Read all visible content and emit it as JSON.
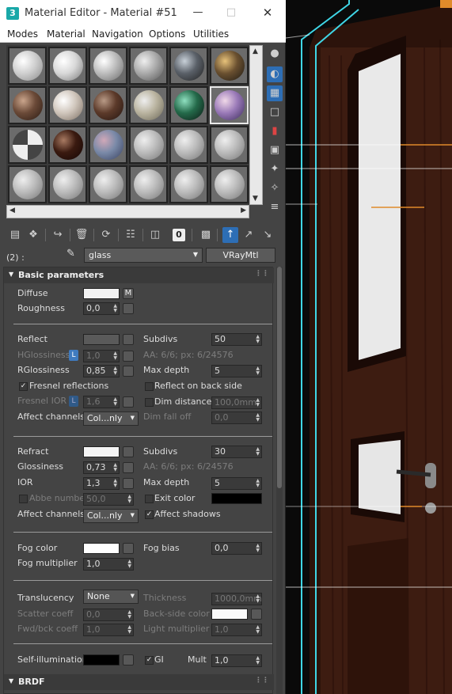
{
  "window": {
    "app_icon": "3",
    "title": "Material Editor - Material #51"
  },
  "menu": [
    "Modes",
    "Material",
    "Navigation",
    "Options",
    "Utilities"
  ],
  "material_row": {
    "slot_label": "(2) :",
    "name": "glass",
    "type": "VRayMtl"
  },
  "basic": {
    "header": "Basic parameters",
    "diffuse_label": "Diffuse",
    "diffuse_map_btn": "M",
    "roughness_label": "Roughness",
    "roughness": "0,0",
    "reflect_label": "Reflect",
    "subdivs_label": "Subdivs",
    "reflect_subdivs": "50",
    "hglossiness_label": "HGlossiness",
    "lock_label": "L",
    "hglossiness": "1,0",
    "aa_info": "AA: 6/6; px: 6/24576",
    "rglossiness_label": "RGlossiness",
    "rglossiness": "0,85",
    "max_depth_label": "Max depth",
    "reflect_max_depth": "5",
    "fresnel_label": "Fresnel reflections",
    "reflect_back_label": "Reflect on back side",
    "fresnel_ior_label": "Fresnel IOR",
    "fresnel_ior": "1,6",
    "dim_distance_label": "Dim distance",
    "dim_distance": "100,0mm",
    "affect_channels_label": "Affect channels",
    "affect_channels": "Col...nly",
    "dim_falloff_label": "Dim fall off",
    "dim_falloff": "0,0",
    "refract_label": "Refract",
    "refract_subdivs": "30",
    "refract_aa_info": "AA: 6/6; px: 6/24576",
    "glossiness_label": "Glossiness",
    "glossiness": "0,73",
    "ior_label": "IOR",
    "ior": "1,3",
    "refract_max_depth": "5",
    "abbe_label": "Abbe number",
    "abbe": "50,0",
    "exit_color_label": "Exit color",
    "refract_affect_channels": "Col...nly",
    "affect_shadows_label": "Affect shadows",
    "fog_color_label": "Fog color",
    "fog_bias_label": "Fog bias",
    "fog_bias": "0,0",
    "fog_multiplier_label": "Fog multiplier",
    "fog_multiplier": "1,0",
    "translucency_label": "Translucency",
    "translucency": "None",
    "thickness_label": "Thickness",
    "thickness": "1000,0mm",
    "scatter_label": "Scatter coeff",
    "scatter": "0,0",
    "backside_label": "Back-side color",
    "fwdbck_label": "Fwd/bck coeff",
    "fwdbck": "1,0",
    "light_mult_label": "Light multiplier",
    "light_mult": "1,0",
    "selfillum_label": "Self-illumination",
    "gi_label": "GI",
    "mult_label": "Mult",
    "mult": "1,0"
  },
  "brdf": {
    "header": "BRDF"
  },
  "colors": {
    "accent": "#2d6eb5",
    "panel": "#444444",
    "viewport_line": "#3fd6e6",
    "door": "#3a1a10",
    "guide": "#e08a2a"
  }
}
